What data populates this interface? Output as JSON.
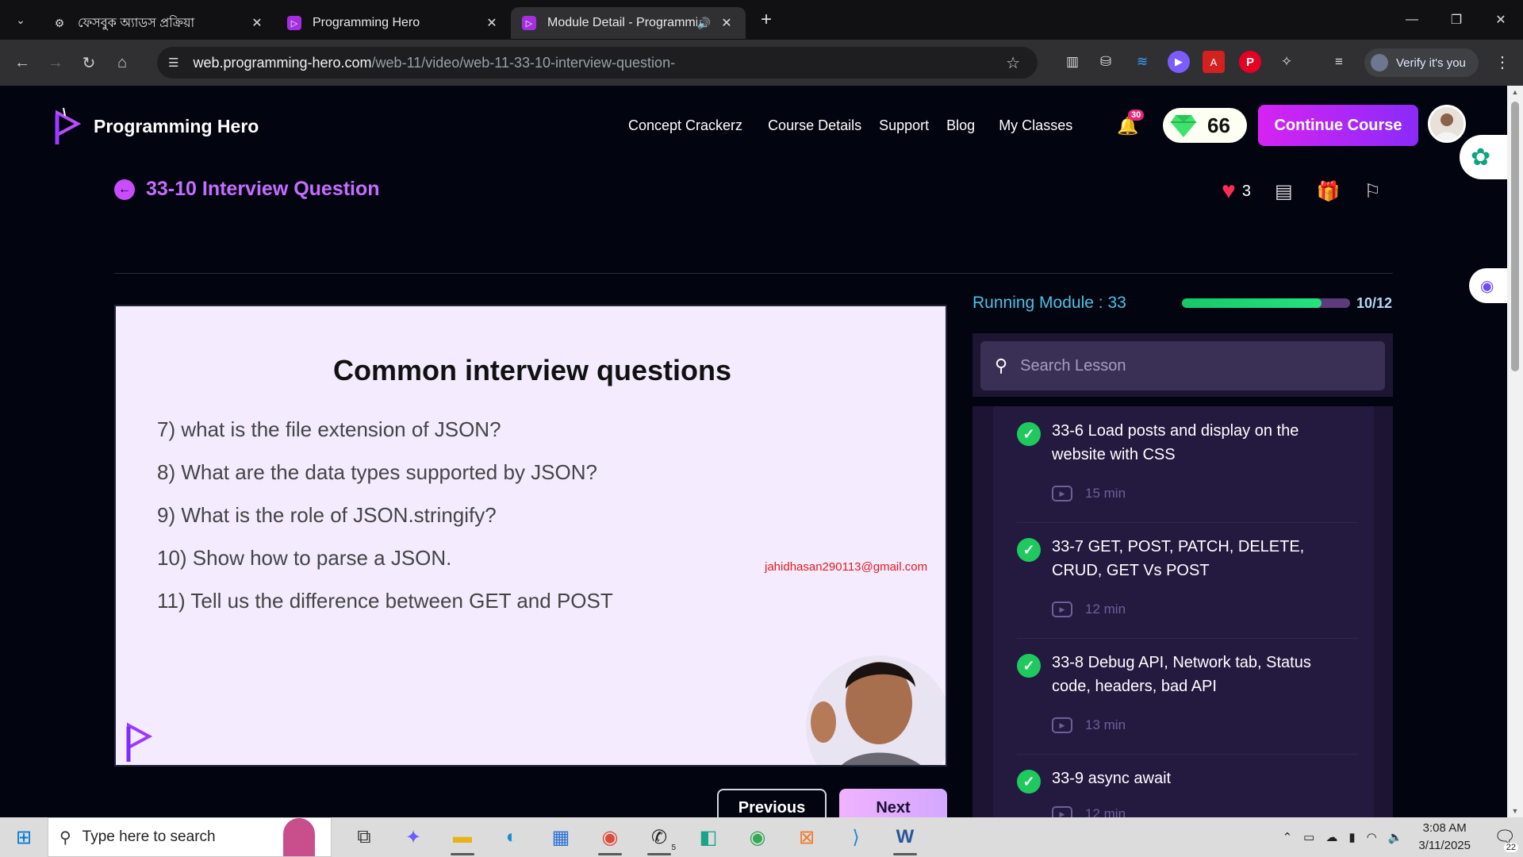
{
  "browser": {
    "tabs": [
      {
        "title": "ফেসবুক অ্যাডস প্রক্রিয়া",
        "favicon": "gear-icon"
      },
      {
        "title": "Programming Hero",
        "favicon": "programming-hero-icon"
      },
      {
        "title": "Module Detail - Programmi",
        "favicon": "programming-hero-icon",
        "audio": true
      }
    ],
    "url_host": "web.programming-hero.com",
    "url_path": "/web-11/video/web-11-33-10-interview-question-",
    "verify_label": "Verify it's you"
  },
  "header": {
    "brand": "Programming Hero",
    "nav": [
      "Concept Crackerz",
      "Course Details",
      "Support",
      "Blog",
      "My Classes"
    ],
    "notification_count": "30",
    "gems": "66",
    "cta": "Continue Course"
  },
  "lesson": {
    "title": "33-10 Interview Question",
    "likes": "3"
  },
  "slide": {
    "title": "Common interview questions",
    "questions": [
      "7) what is the file extension of JSON?",
      "8) What are the data types supported by JSON?",
      "9) What is the role of JSON.stringify?",
      "10) Show how to parse a JSON.",
      "11) Tell us the difference between GET and POST"
    ],
    "watermark_email": "jahidhasan290113@gmail.com"
  },
  "pager": {
    "previous": "Previous",
    "next": "Next"
  },
  "sidebar": {
    "module_label": "Running Module : 33",
    "progress_fraction": 0.83,
    "progress_text": "10/12",
    "search_placeholder": "Search Lesson",
    "lessons": [
      {
        "title": "33-6 Load posts and display on the website with CSS",
        "duration": "15 min"
      },
      {
        "title": "33-7 GET, POST, PATCH, DELETE, CRUD, GET Vs POST",
        "duration": "12 min"
      },
      {
        "title": "33-8 Debug API, Network tab, Status code, headers, bad API",
        "duration": "13 min"
      },
      {
        "title": "33-9 async await",
        "duration": "12 min"
      }
    ]
  },
  "taskbar": {
    "search_placeholder": "Type here to search",
    "time": "3:08 AM",
    "date": "3/11/2025",
    "notification_count": "22",
    "whatsapp_badge": "5"
  }
}
